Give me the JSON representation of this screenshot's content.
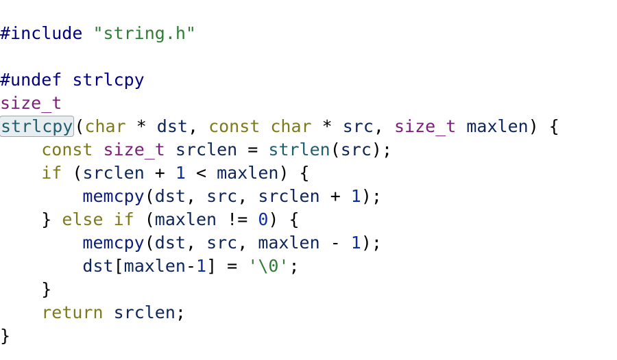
{
  "editor": {
    "lines": [
      [
        {
          "t": "#include ",
          "c": "t-directive"
        },
        {
          "t": "\"string.h\"",
          "c": "t-string"
        }
      ],
      [],
      [
        {
          "t": "#undef strlcpy",
          "c": "t-directive"
        }
      ],
      [
        {
          "t": "size_t",
          "c": "t-type"
        }
      ],
      [
        {
          "t": "strlcpy",
          "c": "t-func",
          "hl": true
        },
        {
          "t": "(",
          "c": "t-plain"
        },
        {
          "t": "char",
          "c": "t-keyword"
        },
        {
          "t": " * ",
          "c": "t-plain"
        },
        {
          "t": "dst",
          "c": "t-var"
        },
        {
          "t": ", ",
          "c": "t-plain"
        },
        {
          "t": "const char",
          "c": "t-keyword"
        },
        {
          "t": " * ",
          "c": "t-plain"
        },
        {
          "t": "src",
          "c": "t-var"
        },
        {
          "t": ", ",
          "c": "t-plain"
        },
        {
          "t": "size_t",
          "c": "t-type"
        },
        {
          "t": " ",
          "c": "t-plain"
        },
        {
          "t": "maxlen",
          "c": "t-var"
        },
        {
          "t": ") {",
          "c": "t-plain"
        }
      ],
      [
        {
          "t": "    ",
          "c": "t-plain"
        },
        {
          "t": "const",
          "c": "t-keyword"
        },
        {
          "t": " ",
          "c": "t-plain"
        },
        {
          "t": "size_t",
          "c": "t-type"
        },
        {
          "t": " ",
          "c": "t-plain"
        },
        {
          "t": "srclen",
          "c": "t-var"
        },
        {
          "t": " = ",
          "c": "t-plain"
        },
        {
          "t": "strlen",
          "c": "t-func"
        },
        {
          "t": "(",
          "c": "t-plain"
        },
        {
          "t": "src",
          "c": "t-var"
        },
        {
          "t": ");",
          "c": "t-plain"
        }
      ],
      [
        {
          "t": "    ",
          "c": "t-plain"
        },
        {
          "t": "if",
          "c": "t-keyword"
        },
        {
          "t": " (",
          "c": "t-plain"
        },
        {
          "t": "srclen",
          "c": "t-var"
        },
        {
          "t": " + ",
          "c": "t-plain"
        },
        {
          "t": "1",
          "c": "t-number"
        },
        {
          "t": " < ",
          "c": "t-plain"
        },
        {
          "t": "maxlen",
          "c": "t-var"
        },
        {
          "t": ") {",
          "c": "t-plain"
        }
      ],
      [
        {
          "t": "        ",
          "c": "t-plain"
        },
        {
          "t": "memcpy",
          "c": "t-call"
        },
        {
          "t": "(",
          "c": "t-plain"
        },
        {
          "t": "dst",
          "c": "t-var"
        },
        {
          "t": ", ",
          "c": "t-plain"
        },
        {
          "t": "src",
          "c": "t-var"
        },
        {
          "t": ", ",
          "c": "t-plain"
        },
        {
          "t": "srclen",
          "c": "t-var"
        },
        {
          "t": " + ",
          "c": "t-plain"
        },
        {
          "t": "1",
          "c": "t-number"
        },
        {
          "t": ");",
          "c": "t-plain"
        }
      ],
      [
        {
          "t": "    } ",
          "c": "t-plain"
        },
        {
          "t": "else if",
          "c": "t-keyword"
        },
        {
          "t": " (",
          "c": "t-plain"
        },
        {
          "t": "maxlen",
          "c": "t-var"
        },
        {
          "t": " != ",
          "c": "t-plain"
        },
        {
          "t": "0",
          "c": "t-number"
        },
        {
          "t": ") {",
          "c": "t-plain"
        }
      ],
      [
        {
          "t": "        ",
          "c": "t-plain"
        },
        {
          "t": "memcpy",
          "c": "t-call"
        },
        {
          "t": "(",
          "c": "t-plain"
        },
        {
          "t": "dst",
          "c": "t-var"
        },
        {
          "t": ", ",
          "c": "t-plain"
        },
        {
          "t": "src",
          "c": "t-var"
        },
        {
          "t": ", ",
          "c": "t-plain"
        },
        {
          "t": "maxlen",
          "c": "t-var"
        },
        {
          "t": " - ",
          "c": "t-plain"
        },
        {
          "t": "1",
          "c": "t-number"
        },
        {
          "t": ");",
          "c": "t-plain"
        }
      ],
      [
        {
          "t": "        ",
          "c": "t-plain"
        },
        {
          "t": "dst",
          "c": "t-var"
        },
        {
          "t": "[",
          "c": "t-plain"
        },
        {
          "t": "maxlen",
          "c": "t-var"
        },
        {
          "t": "-",
          "c": "t-plain"
        },
        {
          "t": "1",
          "c": "t-number"
        },
        {
          "t": "] = ",
          "c": "t-plain"
        },
        {
          "t": "'\\0'",
          "c": "t-string"
        },
        {
          "t": ";",
          "c": "t-plain"
        }
      ],
      [
        {
          "t": "    }",
          "c": "t-plain"
        }
      ],
      [
        {
          "t": "    ",
          "c": "t-plain"
        },
        {
          "t": "return",
          "c": "t-keyword"
        },
        {
          "t": " ",
          "c": "t-plain"
        },
        {
          "t": "srclen",
          "c": "t-var"
        },
        {
          "t": ";",
          "c": "t-plain"
        }
      ],
      [
        {
          "t": "}",
          "c": "t-plain"
        }
      ]
    ]
  },
  "colors": {
    "directive": "#000080",
    "string": "#2e7d32",
    "type": "#7b1e7a",
    "keyword": "#7d7a1c",
    "identifier": "#0d2559",
    "function": "#1f5f6e",
    "number": "#0b2fa1",
    "highlight_bg": "#e8eef0"
  }
}
